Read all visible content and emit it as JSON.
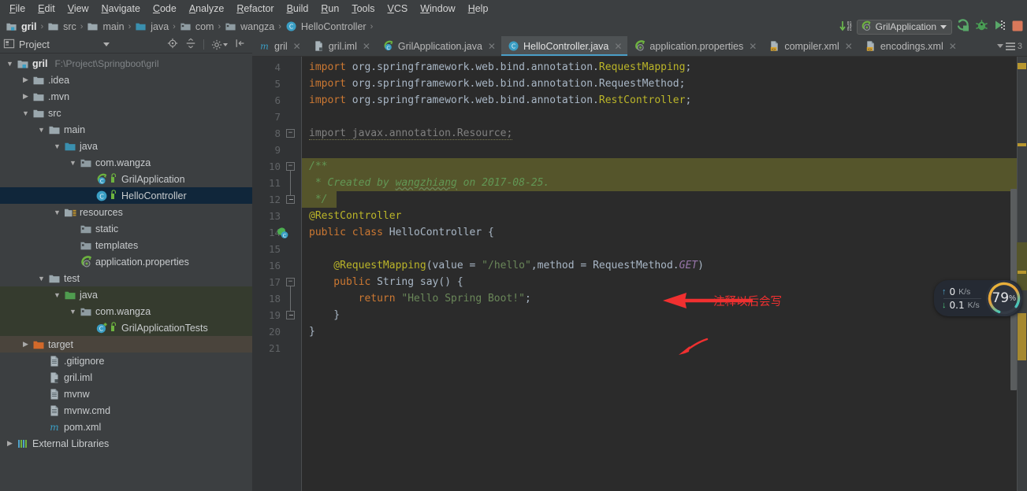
{
  "menu": {
    "items": [
      "File",
      "Edit",
      "View",
      "Navigate",
      "Code",
      "Analyze",
      "Refactor",
      "Build",
      "Run",
      "Tools",
      "VCS",
      "Window",
      "Help"
    ]
  },
  "breadcrumb": {
    "items": [
      {
        "label": "gril",
        "icon": "module-icon"
      },
      {
        "label": "src",
        "icon": "folder-icon"
      },
      {
        "label": "main",
        "icon": "folder-icon"
      },
      {
        "label": "java",
        "icon": "source-folder-icon"
      },
      {
        "label": "com",
        "icon": "package-icon"
      },
      {
        "label": "wangza",
        "icon": "package-icon"
      },
      {
        "label": "HelloController",
        "icon": "class-icon"
      }
    ],
    "separator": "›"
  },
  "toolbar": {
    "update_label": "update-project-icon",
    "run_config": "GrilApplication",
    "buttons": [
      "run-button",
      "debug-button",
      "run-coverage-button",
      "stop-button"
    ]
  },
  "project_pane": {
    "title": "Project",
    "tools": [
      "locate-icon",
      "collapse-all-icon",
      "settings-gear-icon",
      "hide-icon"
    ],
    "tree": [
      {
        "depth": 0,
        "twist": "▼",
        "icon": "module-icon",
        "label": "gril",
        "bold": true,
        "path": "F:\\Project\\Springboot\\gril"
      },
      {
        "depth": 1,
        "twist": "▶",
        "icon": "folder-icon",
        "label": ".idea"
      },
      {
        "depth": 1,
        "twist": "▶",
        "icon": "folder-icon",
        "label": ".mvn"
      },
      {
        "depth": 1,
        "twist": "▼",
        "icon": "folder-icon",
        "label": "src"
      },
      {
        "depth": 2,
        "twist": "▼",
        "icon": "folder-icon",
        "label": "main"
      },
      {
        "depth": 3,
        "twist": "▼",
        "icon": "source-folder-icon",
        "label": "java"
      },
      {
        "depth": 4,
        "twist": "▼",
        "icon": "package-icon",
        "label": "com.wangza"
      },
      {
        "depth": 5,
        "twist": "",
        "icon": "spring-class-icon",
        "label": "GrilApplication"
      },
      {
        "depth": 5,
        "twist": "",
        "icon": "class-icon",
        "label": "HelloController",
        "state": "selected"
      },
      {
        "depth": 3,
        "twist": "▼",
        "icon": "resources-folder-icon",
        "label": "resources"
      },
      {
        "depth": 4,
        "twist": "",
        "icon": "package-icon",
        "label": "static"
      },
      {
        "depth": 4,
        "twist": "",
        "icon": "package-icon",
        "label": "templates"
      },
      {
        "depth": 4,
        "twist": "",
        "icon": "spring-leaf-icon",
        "label": "application.properties"
      },
      {
        "depth": 2,
        "twist": "▼",
        "icon": "folder-icon",
        "label": "test"
      },
      {
        "depth": 3,
        "twist": "▼",
        "icon": "test-folder-icon",
        "label": "java",
        "state": "testbg"
      },
      {
        "depth": 4,
        "twist": "▼",
        "icon": "package-icon",
        "label": "com.wangza",
        "state": "testbg"
      },
      {
        "depth": 5,
        "twist": "",
        "icon": "test-class-icon",
        "label": "GrilApplicationTests",
        "state": "testbg"
      },
      {
        "depth": 1,
        "twist": "▶",
        "icon": "target-folder-icon",
        "label": "target",
        "state": "targetbg"
      },
      {
        "depth": 2,
        "twist": "",
        "icon": "file-icon",
        "label": ".gitignore"
      },
      {
        "depth": 2,
        "twist": "",
        "icon": "iml-icon",
        "label": "gril.iml"
      },
      {
        "depth": 2,
        "twist": "",
        "icon": "file-icon",
        "label": "mvnw"
      },
      {
        "depth": 2,
        "twist": "",
        "icon": "file-icon",
        "label": "mvnw.cmd"
      },
      {
        "depth": 2,
        "twist": "",
        "icon": "maven-icon",
        "label": "pom.xml"
      },
      {
        "depth": 0,
        "twist": "▶",
        "icon": "libraries-icon",
        "label": "External Libraries"
      }
    ]
  },
  "editor_tabs": {
    "items": [
      {
        "label": "gril",
        "icon": "maven-icon",
        "active": false
      },
      {
        "label": "gril.iml",
        "icon": "iml-icon",
        "active": false
      },
      {
        "label": "GrilApplication.java",
        "icon": "spring-class-icon",
        "active": false
      },
      {
        "label": "HelloController.java",
        "icon": "class-icon",
        "active": true
      },
      {
        "label": "application.properties",
        "icon": "spring-leaf-icon",
        "active": false
      },
      {
        "label": "compiler.xml",
        "icon": "xml-icon",
        "active": false
      },
      {
        "label": "encodings.xml",
        "icon": "xml-icon",
        "active": false
      }
    ],
    "close_glyph": "✕",
    "more_count": "3"
  },
  "code": {
    "first_line_number": 4,
    "lines": [
      {
        "n": 4,
        "tokens": [
          {
            "t": "import ",
            "c": "kw"
          },
          {
            "t": "org.springframework.web.bind.annotation.",
            "c": "txt"
          },
          {
            "t": "RequestMapping",
            "c": "anno"
          },
          {
            "t": ";",
            "c": "txt"
          }
        ]
      },
      {
        "n": 5,
        "tokens": [
          {
            "t": "import ",
            "c": "kw"
          },
          {
            "t": "org.springframework.web.bind.annotation.RequestMethod;",
            "c": "txt"
          }
        ]
      },
      {
        "n": 6,
        "tokens": [
          {
            "t": "import ",
            "c": "kw"
          },
          {
            "t": "org.springframework.web.bind.annotation.",
            "c": "txt"
          },
          {
            "t": "RestController",
            "c": "anno"
          },
          {
            "t": ";",
            "c": "txt"
          }
        ]
      },
      {
        "n": 7,
        "tokens": []
      },
      {
        "n": 8,
        "tokens": [
          {
            "t": "import javax.annotation.Resource;",
            "c": "dim wavy-g"
          }
        ]
      },
      {
        "n": 9,
        "tokens": []
      },
      {
        "n": 10,
        "tokens": [
          {
            "t": "/**",
            "c": "cmt"
          }
        ],
        "bg": "doc"
      },
      {
        "n": 11,
        "tokens": [
          {
            "t": " * Created by ",
            "c": "cmt"
          },
          {
            "t": "wangzhiang",
            "c": "cmt wavy"
          },
          {
            "t": " on 2017-08-25.",
            "c": "cmt"
          }
        ],
        "bg": "doc"
      },
      {
        "n": 12,
        "tokens": [
          {
            "t": " */",
            "c": "cmt"
          }
        ],
        "bg": "doc"
      },
      {
        "n": 13,
        "tokens": [
          {
            "t": "@RestController",
            "c": "anno"
          }
        ]
      },
      {
        "n": 14,
        "tokens": [
          {
            "t": "public class ",
            "c": "kw"
          },
          {
            "t": "HelloController ",
            "c": "txt"
          },
          {
            "t": "{",
            "c": "txt"
          }
        ],
        "gutter_icon": "spring-bean-icon"
      },
      {
        "n": 15,
        "tokens": []
      },
      {
        "n": 16,
        "tokens": [
          {
            "t": "    @RequestMapping",
            "c": "anno"
          },
          {
            "t": "(value = ",
            "c": "txt"
          },
          {
            "t": "\"/hello\"",
            "c": "str"
          },
          {
            "t": ",method = RequestMethod.",
            "c": "txt"
          },
          {
            "t": "GET",
            "c": "stat"
          },
          {
            "t": ")",
            "c": "txt"
          }
        ]
      },
      {
        "n": 17,
        "tokens": [
          {
            "t": "    public ",
            "c": "kw"
          },
          {
            "t": "String ",
            "c": "txt"
          },
          {
            "t": "say",
            "c": "txt"
          },
          {
            "t": "() {",
            "c": "txt"
          }
        ]
      },
      {
        "n": 18,
        "tokens": [
          {
            "t": "        return ",
            "c": "kw"
          },
          {
            "t": "\"Hello Spring Boot!\"",
            "c": "str"
          },
          {
            "t": ";",
            "c": "txt"
          }
        ]
      },
      {
        "n": 19,
        "tokens": [
          {
            "t": "    }",
            "c": "txt"
          }
        ]
      },
      {
        "n": 20,
        "tokens": [
          {
            "t": "}",
            "c": "txt"
          }
        ]
      },
      {
        "n": 21,
        "tokens": []
      }
    ]
  },
  "annotations": [
    {
      "name": "restcontroller-note",
      "text": "注释以后会写",
      "color": "#f03030"
    },
    {
      "name": "requestmapping-arrow",
      "text": "",
      "color": "#f03030"
    }
  ],
  "perf_widget": {
    "upload": "0",
    "upload_unit": "K/s",
    "download": "0.1",
    "download_unit": "K/s",
    "cpu_percent": "79",
    "percent_sign": "%",
    "up_arrow": "↑",
    "down_arrow": "↓"
  },
  "colors": {
    "accent": "#4a9ec7",
    "panel_bg": "#3c3f41",
    "editor_bg": "#2b2b2b",
    "gutter_bg": "#313335",
    "selection": "#10263a",
    "test_root": "#353b2e",
    "target_dir": "#4a443c",
    "annotation_red": "#f03030",
    "javadoc_bg": "#55552b"
  }
}
